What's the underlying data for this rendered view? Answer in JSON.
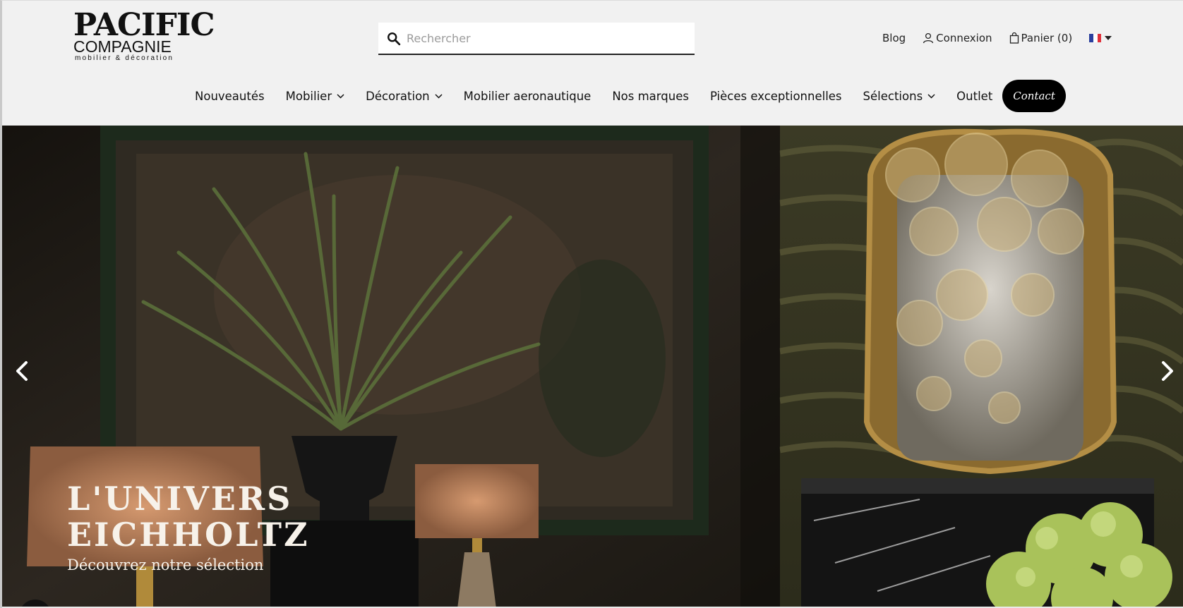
{
  "logo": {
    "line1": "PACIFIC",
    "line2": "COMPAGNIE",
    "line3": "mobilier & décoration"
  },
  "search": {
    "placeholder": "Rechercher",
    "value": ""
  },
  "utilities": {
    "blog": "Blog",
    "login": "Connexion",
    "cart": "Panier (0)",
    "language": "FR"
  },
  "nav": {
    "items": [
      {
        "label": "Nouveautés",
        "dropdown": false
      },
      {
        "label": "Mobilier",
        "dropdown": true
      },
      {
        "label": "Décoration",
        "dropdown": true
      },
      {
        "label": "Mobilier aeronautique",
        "dropdown": false
      },
      {
        "label": "Nos marques",
        "dropdown": false
      },
      {
        "label": "Pièces exceptionnelles",
        "dropdown": false
      },
      {
        "label": "Sélections",
        "dropdown": true
      },
      {
        "label": "Outlet",
        "dropdown": false
      }
    ],
    "contact": "Contact"
  },
  "hero": {
    "title_line1": "L'UNIVERS",
    "title_line2": "EICHHOLTZ",
    "subtitle": "Découvrez notre sélection"
  },
  "colors": {
    "background": "#f1f1f1",
    "text": "#111111",
    "contact_button": "#000000",
    "hero_text": "#f7f2ea"
  }
}
